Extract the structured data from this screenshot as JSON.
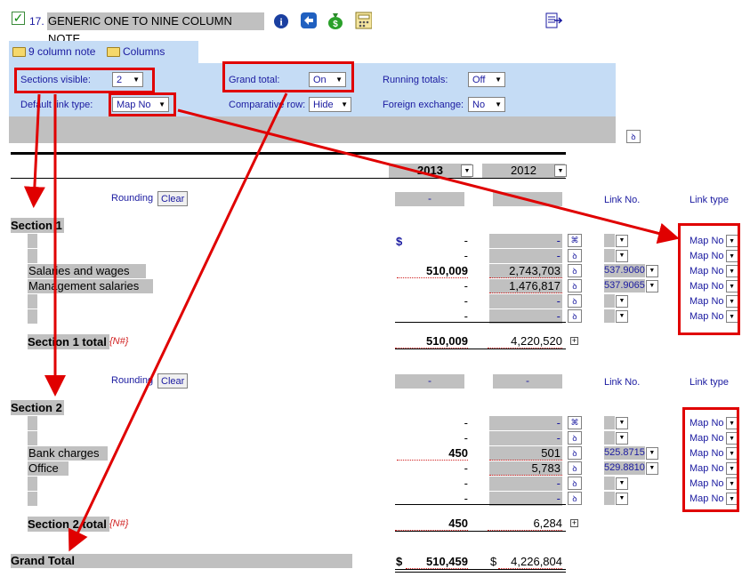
{
  "header": {
    "note_number": "17.",
    "title": "GENERIC ONE TO NINE COLUMN NOTE",
    "toolbar_icons": [
      "info-icon",
      "back-arrow-icon",
      "money-bag-icon",
      "calculator-icon"
    ],
    "export_icon": "export-icon"
  },
  "tabs": [
    {
      "label": "9 column note",
      "active": true
    },
    {
      "label": "Columns",
      "active": false
    }
  ],
  "options": {
    "sections_visible": {
      "label": "Sections visible:",
      "value": "2"
    },
    "grand_total": {
      "label": "Grand total:",
      "value": "On"
    },
    "running_totals": {
      "label": "Running totals:",
      "value": "Off"
    },
    "default_link_type": {
      "label": "Default link type:",
      "value": "Map No"
    },
    "comparative_row": {
      "label": "Comparative row:",
      "value": "Hide"
    },
    "foreign_exchange": {
      "label": "Foreign exchange:",
      "value": "No"
    }
  },
  "columns": {
    "year1": "2013",
    "year2": "2012",
    "link_no": "Link No.",
    "link_type": "Link type",
    "rounding": "Rounding",
    "clear": "Clear",
    "dash": "-"
  },
  "section1": {
    "title": "Section 1",
    "currency": "$",
    "rows": [
      {
        "label": "",
        "y1": "-",
        "y2": "-",
        "btn": "⌘",
        "link": "",
        "type": "Map No"
      },
      {
        "label": "",
        "y1": "-",
        "y2": "-",
        "btn": "ꝺ",
        "link": "",
        "type": "Map No"
      },
      {
        "label": "Salaries and wages",
        "y1": "510,009",
        "y2": "2,743,703",
        "btn": "ꝺ",
        "link": "537.9060",
        "type": "Map No"
      },
      {
        "label": "Management salaries",
        "y1": "-",
        "y2": "1,476,817",
        "btn": "ꝺ",
        "link": "537.9065",
        "type": "Map No"
      },
      {
        "label": "",
        "y1": "-",
        "y2": "-",
        "btn": "ꝺ",
        "link": "",
        "type": "Map No"
      },
      {
        "label": "",
        "y1": "-",
        "y2": "-",
        "btn": "ꝺ",
        "link": "",
        "type": "Map No"
      }
    ],
    "total_label": "Section 1 total",
    "total_flag": "{N#}",
    "total_y1": "510,009",
    "total_y2": "4,220,520"
  },
  "section2": {
    "title": "Section 2",
    "rows": [
      {
        "label": "",
        "y1": "-",
        "y2": "-",
        "btn": "⌘",
        "link": "",
        "type": "Map No"
      },
      {
        "label": "",
        "y1": "-",
        "y2": "-",
        "btn": "ꝺ",
        "link": "",
        "type": "Map No"
      },
      {
        "label": "Bank charges",
        "y1": "450",
        "y2": "501",
        "btn": "ꝺ",
        "link": "525.8715",
        "type": "Map No"
      },
      {
        "label": "Office",
        "y1": "-",
        "y2": "5,783",
        "btn": "ꝺ",
        "link": "529.8810",
        "type": "Map No"
      },
      {
        "label": "",
        "y1": "-",
        "y2": "-",
        "btn": "ꝺ",
        "link": "",
        "type": "Map No"
      },
      {
        "label": "",
        "y1": "-",
        "y2": "-",
        "btn": "ꝺ",
        "link": "",
        "type": "Map No"
      }
    ],
    "total_label": "Section 2 total",
    "total_flag": "{N#}",
    "total_y1": "450",
    "total_y2": "6,284"
  },
  "grand_total": {
    "label": "Grand Total",
    "currency": "$",
    "y1": "510,459",
    "y2": "4,226,804"
  },
  "colors": {
    "accent_blue": "#1a1aa0",
    "panel_blue": "#c5dcf5",
    "gray": "#c0c0c0",
    "annotation_red": "#e00000"
  }
}
